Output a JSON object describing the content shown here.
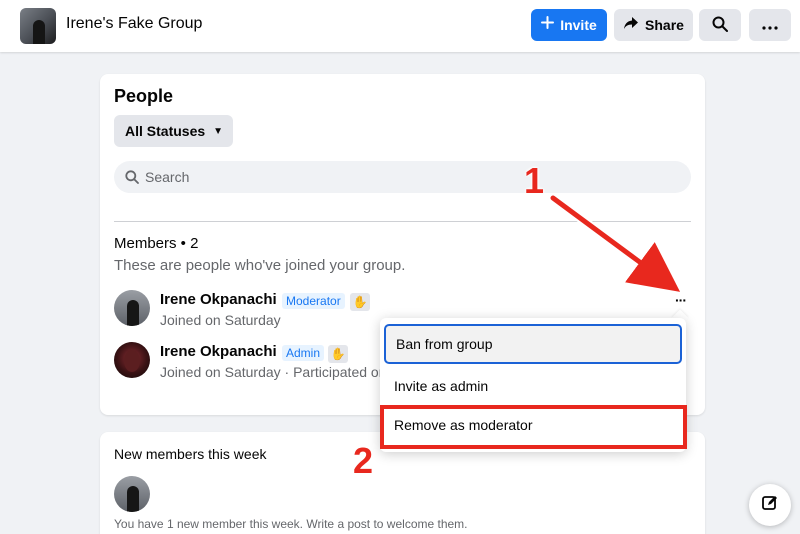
{
  "header": {
    "group_name": "Irene's Fake Group",
    "invite_label": "Invite",
    "share_label": "Share"
  },
  "people": {
    "title": "People",
    "status_filter": "All Statuses",
    "search_placeholder": "Search",
    "members_heading": "Members • 2",
    "members_subtitle": "These are people who've joined your group.",
    "members": [
      {
        "name": "Irene Okpanachi",
        "role": "Moderator",
        "meta": "Joined on Saturday"
      },
      {
        "name": "Irene Okpanachi",
        "role": "Admin",
        "meta": "Joined on Saturday · Participated on"
      }
    ],
    "more_label": "···"
  },
  "menu": {
    "items": [
      {
        "label": "Ban from group"
      },
      {
        "label": "Invite as admin"
      },
      {
        "label": "Remove as moderator"
      }
    ]
  },
  "new_members": {
    "title": "New members this week",
    "text": "You have 1 new member this week. Write a post to welcome them."
  },
  "annotations": {
    "step1": "1",
    "step2": "2",
    "color": "#e8281e"
  },
  "colors": {
    "primary": "#1877f2",
    "background": "#f0f2f5"
  },
  "icons": [
    "plus-icon",
    "share-arrow-icon",
    "search-icon",
    "more-dots-icon",
    "caret-down-icon",
    "wave-icon",
    "compose-icon"
  ]
}
